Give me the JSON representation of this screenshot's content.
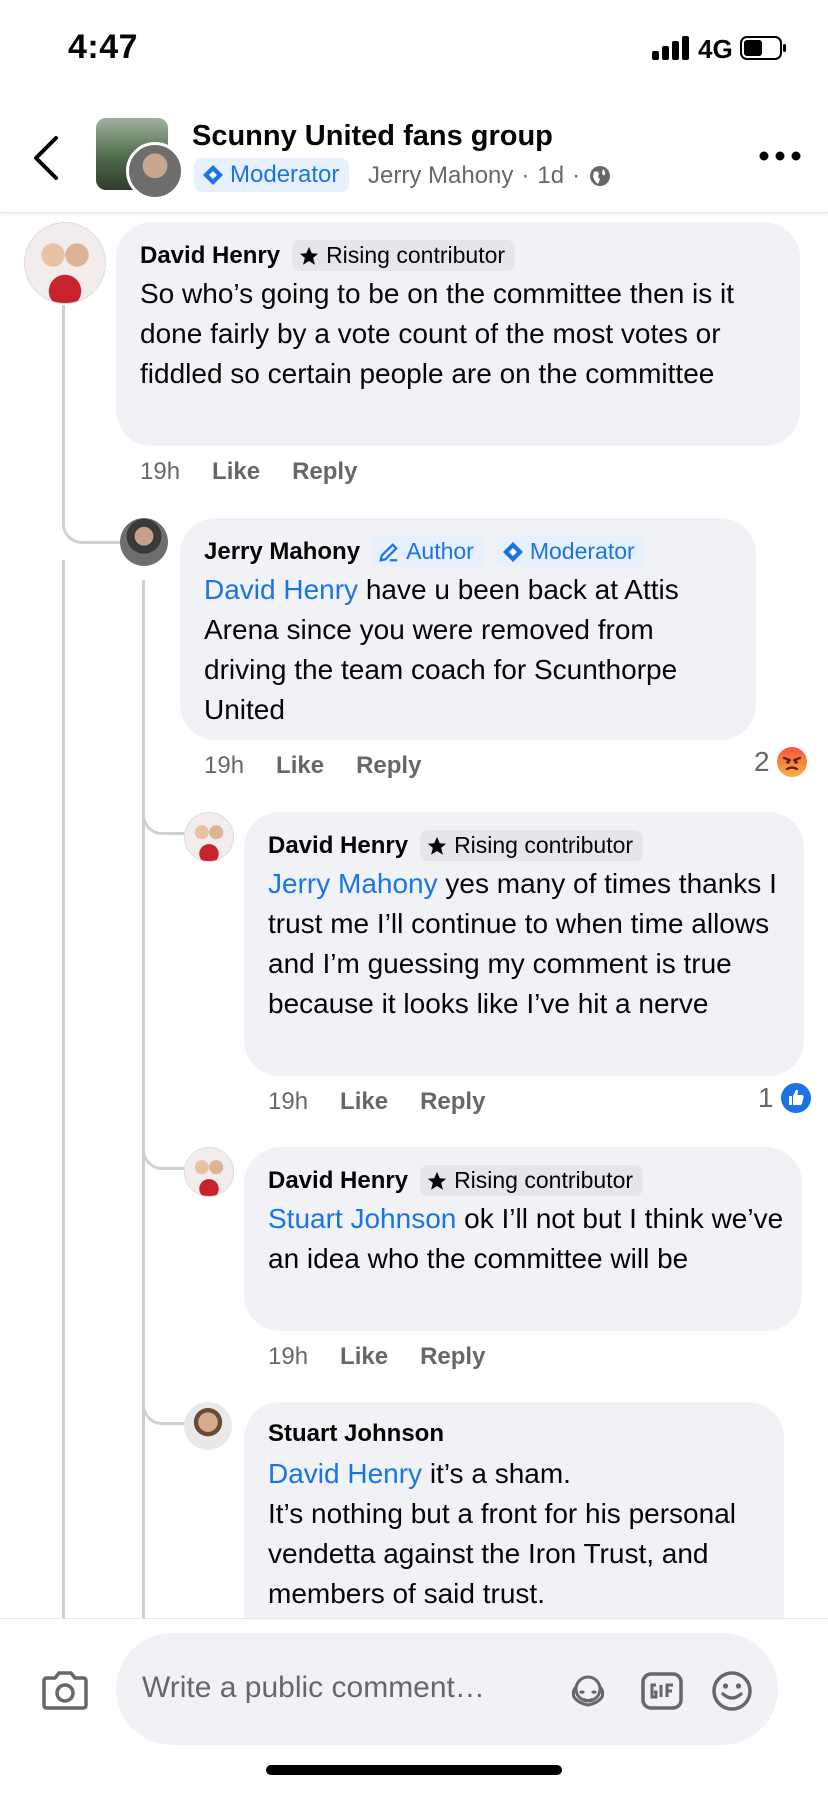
{
  "status_bar": {
    "time": "4:47",
    "network": "4G"
  },
  "header": {
    "group_name": "Scunny United fans group",
    "moderator_label": "Moderator",
    "poster": "Jerry Mahony",
    "age": "1d",
    "separator": "·"
  },
  "comments": [
    {
      "author": "David Henry",
      "badge": "Rising contributor",
      "text": "So who’s going to be on the committee then is it done fairly by a vote count of the most votes or fiddled so certain people are on the committee",
      "time": "19h",
      "like": "Like",
      "reply": "Reply"
    },
    {
      "author": "Jerry Mahony",
      "badge_author": "Author",
      "badge_moderator": "Moderator",
      "mention": "David Henry",
      "text": " have u been back at Attis Arena since you were removed from driving the team coach for Scunthorpe United",
      "time": "19h",
      "like": "Like",
      "reply": "Reply",
      "reaction_count": "2",
      "reaction_type": "angry"
    },
    {
      "author": "David Henry",
      "badge": "Rising contributor",
      "mention": "Jerry Mahony",
      "text": " yes many of times thanks I trust me I’ll continue to when time allows and I’m guessing my comment is true because it looks like I’ve hit a nerve",
      "time": "19h",
      "like": "Like",
      "reply": "Reply",
      "reaction_count": "1",
      "reaction_type": "like"
    },
    {
      "author": "David Henry",
      "badge": "Rising contributor",
      "mention": "Stuart Johnson",
      "text": " ok I’ll not but I think we’ve an idea who the committee will be",
      "time": "19h",
      "like": "Like",
      "reply": "Reply"
    },
    {
      "author": "Stuart Johnson",
      "mention": "David Henry",
      "text": " it’s a sham.",
      "text2": "It’s nothing but a front for his personal vendetta against the Iron Trust, and members of said trust."
    }
  ],
  "composer": {
    "placeholder": "Write a public comment…"
  },
  "colors": {
    "link": "#1b74e4",
    "bubble": "#f0f2f5",
    "muted": "#65676b",
    "angry": "#f5533d"
  }
}
